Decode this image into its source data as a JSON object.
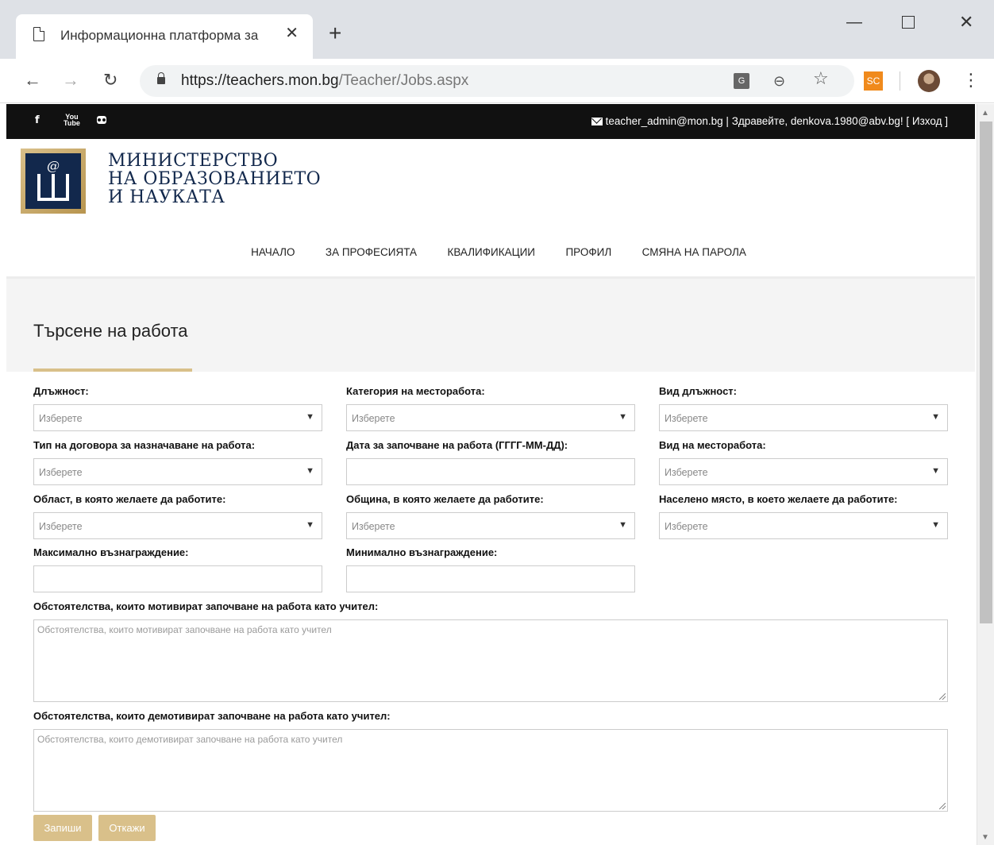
{
  "browser": {
    "tab_title": "Информационна платформа за",
    "tab_close": "✕",
    "new_tab": "+",
    "url_domain": "https://teachers.mon.bg",
    "url_path": "/Teacher/Jobs.aspx",
    "extension_label": "SC",
    "translate_label": "G"
  },
  "topbar": {
    "user_line": "teacher_admin@mon.bg | Здравейте, denkova.1980@abv.bg! [ Изход ]",
    "facebook": "f",
    "youtube": "You Tube"
  },
  "logo": {
    "line1": "МИНИСТЕРСТВО",
    "line2": "НА ОБРАЗОВАНИЕТО",
    "line3": "И НАУКАТА"
  },
  "nav": {
    "items": [
      "НАЧАЛО",
      "ЗА ПРОФЕСИЯТА",
      "КВАЛИФИКАЦИИ",
      "ПРОФИЛ",
      "СМЯНА НА ПАРОЛА"
    ]
  },
  "page": {
    "title": "Търсене на работа"
  },
  "form": {
    "position_label": "Длъжност:",
    "position_value": "Изберете",
    "category_label": "Категория на месторабота:",
    "category_value": "Изберете",
    "position_type_label": "Вид длъжност:",
    "position_type_value": "Изберете",
    "contract_label": "Тип на договора за назначаване на работа:",
    "contract_value": "Изберете",
    "start_date_label": "Дата за започване на работа (ГГГГ-ММ-ДД):",
    "start_date_value": "",
    "workplace_type_label": "Вид на месторабота:",
    "workplace_type_value": "Изберете",
    "region_label": "Област, в която желаете да работите:",
    "region_value": "Изберете",
    "municipality_label": "Община, в която желаете да работите:",
    "municipality_value": "Изберете",
    "settlement_label": "Населено място, в което желаете да работите:",
    "settlement_value": "Изберете",
    "max_salary_label": "Максимално възнаграждение:",
    "max_salary_value": "",
    "min_salary_label": "Минимално възнаграждение:",
    "min_salary_value": "",
    "motivating_label": "Обстоятелства, които мотивират започване на работа като учител:",
    "motivating_placeholder": "Обстоятелства, които мотивират започване на работа като учител",
    "demotivating_label": "Обстоятелства, които демотивират започване на работа като учител:",
    "demotivating_placeholder": "Обстоятелства, които демотивират започване на работа като учител",
    "save_label": "Запиши",
    "cancel_label": "Откажи"
  },
  "colors": {
    "accent": "#d9c08a",
    "topbar": "#111111",
    "logo_navy": "#12284c"
  }
}
